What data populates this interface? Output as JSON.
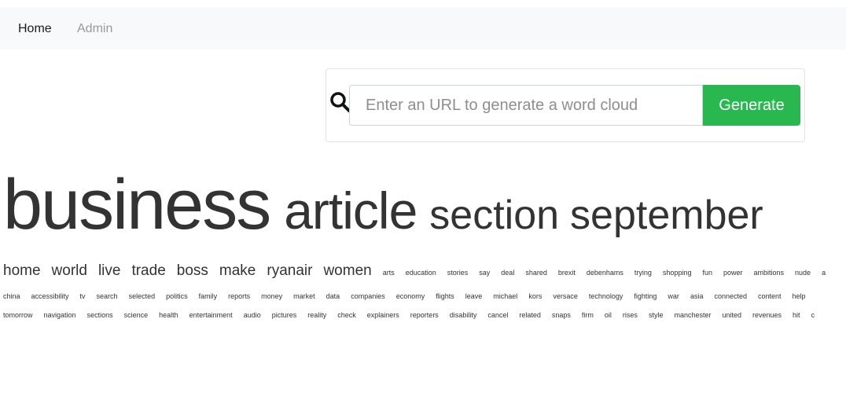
{
  "nav": {
    "home_label": "Home",
    "admin_label": "Admin"
  },
  "search": {
    "placeholder": "Enter an URL to generate a word cloud",
    "value": "",
    "button_label": "Generate"
  },
  "colors": {
    "navbar_bg": "#f8f9fa",
    "generate_button": "#28b84f",
    "word_color": "#333333"
  },
  "cloud": {
    "line1": [
      "business",
      "article",
      "section",
      "september"
    ],
    "line2_big": [
      "home",
      "world",
      "live",
      "trade",
      "boss",
      "make",
      "ryanair",
      "women"
    ],
    "line2_small": [
      "arts",
      "education",
      "stories",
      "say",
      "deal",
      "shared",
      "brexit",
      "debenhams",
      "trying",
      "shopping",
      "fun",
      "power",
      "ambitions",
      "nude",
      "a"
    ],
    "line3": [
      "china",
      "accessibility",
      "tv",
      "search",
      "selected",
      "politics",
      "family",
      "reports",
      "money",
      "market",
      "data",
      "companies",
      "economy",
      "flights",
      "leave",
      "michael",
      "kors",
      "versace",
      "technology",
      "fighting",
      "war",
      "asia",
      "connected",
      "content",
      "help"
    ],
    "line4": [
      "tomorrow",
      "navigation",
      "sections",
      "science",
      "health",
      "entertainment",
      "audio",
      "pictures",
      "reality",
      "check",
      "explainers",
      "reporters",
      "disability",
      "cancel",
      "related",
      "snaps",
      "firm",
      "oil",
      "rises",
      "style",
      "manchester",
      "united",
      "revenues",
      "hit",
      "c"
    ]
  }
}
